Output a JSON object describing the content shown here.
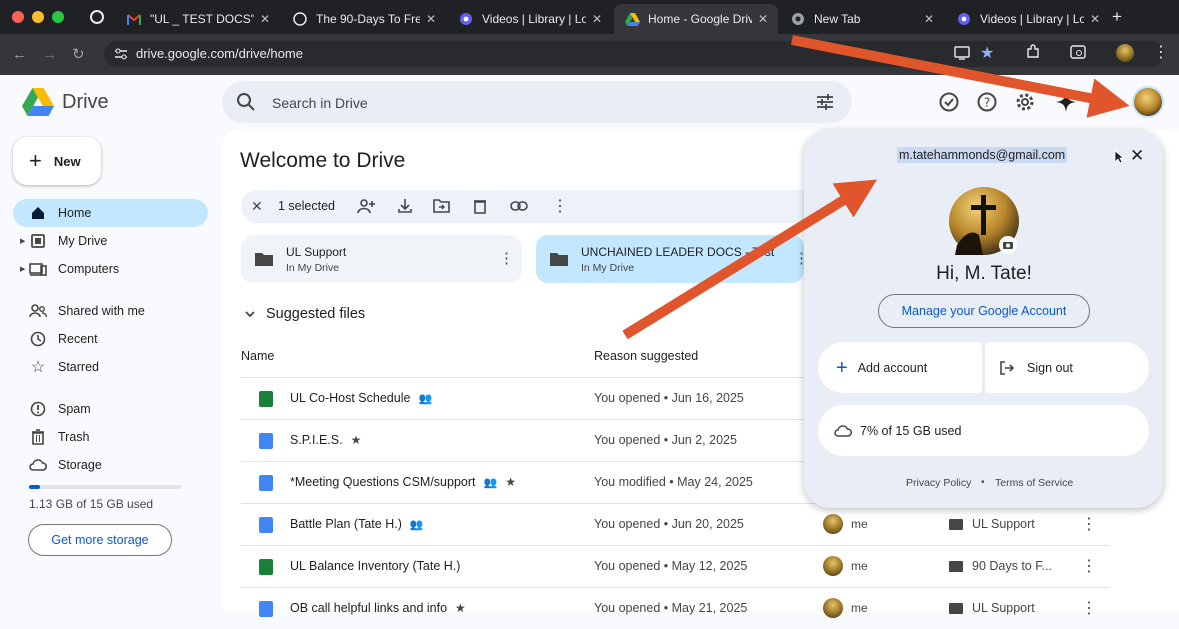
{
  "browser": {
    "tabs": [
      {
        "title": "\"UL _ TEST DOCS\" -",
        "icon": "gmail-icon"
      },
      {
        "title": "The 90-Days To Free",
        "icon": "web-icon"
      },
      {
        "title": "Videos | Library | Loo",
        "icon": "loom-icon"
      },
      {
        "title": "Home - Google Drive",
        "icon": "drive-icon"
      },
      {
        "title": "New Tab",
        "icon": "chrome-icon"
      },
      {
        "title": "Videos | Library | Loo",
        "icon": "loom-icon"
      }
    ],
    "url": "drive.google.com/drive/home"
  },
  "drive": {
    "logo_text": "Drive",
    "search_placeholder": "Search in Drive",
    "new_label": "New",
    "sidebar": [
      {
        "label": "Home"
      },
      {
        "label": "My Drive"
      },
      {
        "label": "Computers"
      },
      {
        "label": "Shared with me"
      },
      {
        "label": "Recent"
      },
      {
        "label": "Starred"
      },
      {
        "label": "Spam"
      },
      {
        "label": "Trash"
      },
      {
        "label": "Storage"
      }
    ],
    "storage_text": "1.13 GB of 15 GB used",
    "storage_fraction": 0.075,
    "get_more_storage": "Get more storage",
    "welcome": "Welcome to Drive",
    "selected_text": "1 selected",
    "cards": [
      {
        "name": "UL Support",
        "sub": "In My Drive"
      },
      {
        "name": "UNCHAINED LEADER DOCS - Test",
        "sub": "In My Drive"
      }
    ],
    "suggested_label": "Suggested files",
    "columns": {
      "name": "Name",
      "reason": "Reason suggested"
    },
    "files": [
      {
        "name": "UL Co-Host Schedule",
        "type": "sheet",
        "shared": true,
        "starred": false,
        "reason": "You opened • Jun 16, 2025",
        "owner": "",
        "location": ""
      },
      {
        "name": "S.P.I.E.S.",
        "type": "doc",
        "shared": false,
        "starred": true,
        "reason": "You opened • Jun 2, 2025",
        "owner": "",
        "location": ""
      },
      {
        "name": "*Meeting Questions CSM/support",
        "type": "doc",
        "shared": true,
        "starred": true,
        "reason": "You modified • May 24, 2025",
        "owner": "",
        "location": ""
      },
      {
        "name": "Battle Plan (Tate H.)",
        "type": "doc",
        "shared": true,
        "starred": false,
        "reason": "You opened • Jun 20, 2025",
        "owner": "me",
        "location": "UL Support"
      },
      {
        "name": "UL Balance Inventory (Tate H.)",
        "type": "sheet",
        "shared": false,
        "starred": false,
        "reason": "You opened • May 12, 2025",
        "owner": "me",
        "location": "90 Days to F..."
      },
      {
        "name": "OB call helpful links and info",
        "type": "doc",
        "shared": false,
        "starred": true,
        "reason": "You opened • May 21, 2025",
        "owner": "me",
        "location": "UL Support"
      }
    ]
  },
  "account_popup": {
    "email": "m.tatehammonds@gmail.com",
    "greeting": "Hi, M. Tate!",
    "manage": "Manage your Google Account",
    "add_account": "Add account",
    "sign_out": "Sign out",
    "storage": "7% of 15 GB used",
    "privacy": "Privacy Policy",
    "separator": "•",
    "terms": "Terms of Service"
  },
  "colors": {
    "accent": "#0b57d0",
    "selected": "#c2e7ff",
    "arrow": "#e0552b",
    "sheet": "#188038",
    "doc": "#4285f4"
  }
}
